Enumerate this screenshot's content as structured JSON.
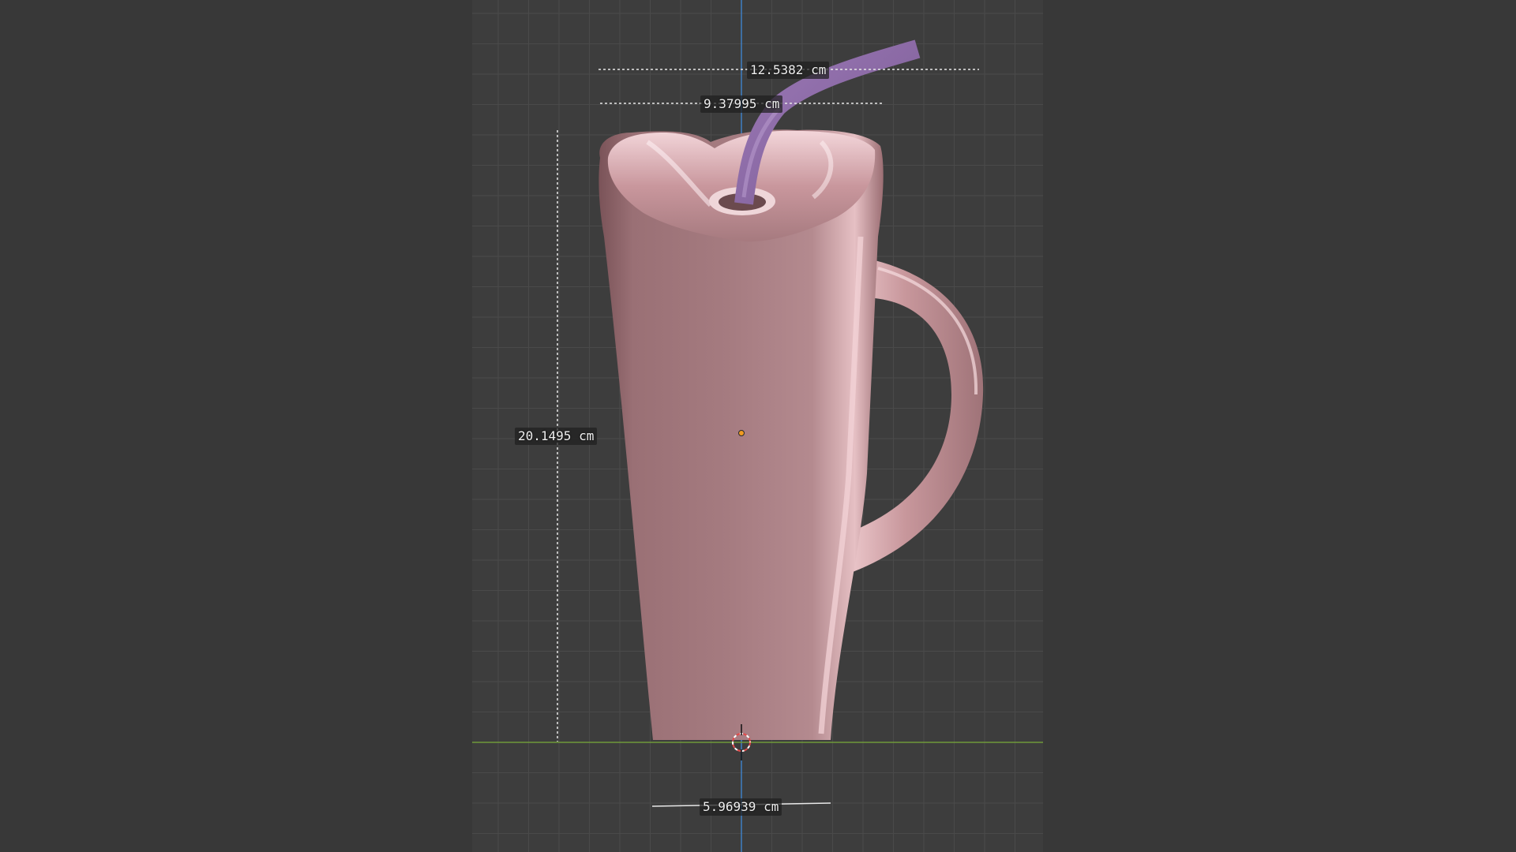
{
  "viewport": {
    "background_color": "#383838",
    "grid_color": "#4a4a4a",
    "axis_z_color": "#3f7fc4",
    "axis_x_color": "#6f9a3a",
    "object_color": "#c49a9f",
    "straw_color": "#8e6aa8",
    "origin_color": "#f09a20"
  },
  "measurements": {
    "overall_width": "12.5382 cm",
    "rim_width": "9.37995 cm",
    "height": "20.1495 cm",
    "base_width": "5.96939 cm"
  },
  "icons": {
    "cursor": "3d-cursor-icon",
    "origin": "object-origin-icon"
  }
}
